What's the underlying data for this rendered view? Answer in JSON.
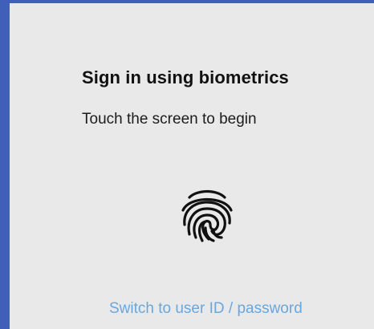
{
  "dialog": {
    "title": "Sign in using biometrics",
    "subtitle": "Touch the screen to begin",
    "icon": "fingerprint-icon",
    "alt_sign_in_label": "Switch to user ID / password"
  },
  "colors": {
    "frame_border": "#3f5fb8",
    "background": "#e9e9e9",
    "title_text": "#111111",
    "link_text": "#6aa7dd"
  }
}
